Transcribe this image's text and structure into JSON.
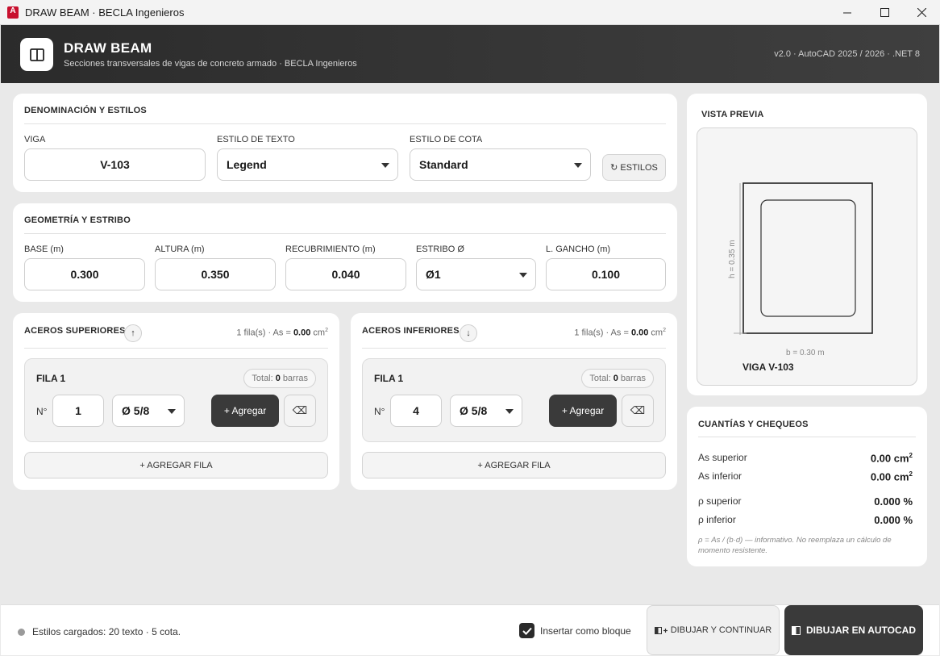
{
  "window": {
    "title": "DRAW BEAM · BECLA Ingenieros",
    "app_icon_letter": "A"
  },
  "header": {
    "title": "DRAW BEAM",
    "subtitle": "Secciones transversales de vigas de concreto armado · BECLA Ingenieros",
    "version": "v2.0 · AutoCAD 2025 / 2026 · .NET 8"
  },
  "denominacion": {
    "title": "DENOMINACIÓN Y ESTILOS",
    "viga_label": "VIGA",
    "viga_value": "V-103",
    "texto_label": "ESTILO DE TEXTO",
    "texto_value": "Legend",
    "cota_label": "ESTILO DE COTA",
    "cota_value": "Standard",
    "estilos_button": "↻ ESTILOS"
  },
  "geometria": {
    "title": "GEOMETRÍA Y ESTRIBO",
    "base_label": "BASE (m)",
    "base_value": "0.300",
    "altura_label": "ALTURA (m)",
    "altura_value": "0.350",
    "recub_label": "RECUBRIMIENTO (m)",
    "recub_value": "0.040",
    "estribo_label": "ESTRIBO Ø",
    "estribo_value": "Ø1",
    "gancho_label": "L. GANCHO (m)",
    "gancho_value": "0.100"
  },
  "superiores": {
    "title": "ACEROS SUPERIORES",
    "arrow": "↑",
    "info_prefix": "1 fila(s) · As = ",
    "info_value": "0.00",
    "info_unit": "cm",
    "info_exp": "2",
    "row_title": "FILA 1",
    "total_prefix": "Total:",
    "total_value": "0",
    "total_suffix": "barras",
    "n_label": "N°",
    "n_value": "1",
    "diam_value": "Ø 5/8",
    "add_button": "+ Agregar",
    "clear_icon": "⌫",
    "add_row_button": "+ AGREGAR FILA"
  },
  "inferiores": {
    "title": "ACEROS INFERIORES",
    "arrow": "↓",
    "info_prefix": "1 fila(s) · As = ",
    "info_value": "0.00",
    "info_unit": "cm",
    "info_exp": "2",
    "row_title": "FILA 1",
    "total_prefix": "Total:",
    "total_value": "0",
    "total_suffix": "barras",
    "n_label": "N°",
    "n_value": "4",
    "diam_value": "Ø 5/8",
    "add_button": "+ Agregar",
    "clear_icon": "⌫",
    "add_row_button": "+ AGREGAR FILA"
  },
  "preview": {
    "title": "VISTA PREVIA",
    "h_label": "h = 0.35 m",
    "b_label": "b = 0.30 m",
    "beam_name": "VIGA V-103"
  },
  "cuantias": {
    "title": "CUANTÍAS Y CHEQUEOS",
    "as_sup_label": "As superior",
    "as_sup_value": "0.00 cm",
    "as_inf_label": "As inferior",
    "as_inf_value": "0.00 cm",
    "unit_exp": "2",
    "rho_sup_label": "ρ superior",
    "rho_sup_value": "0.000 %",
    "rho_inf_label": "ρ inferior",
    "rho_inf_value": "0.000 %",
    "note": "ρ = As / (b·d) — informativo. No reemplaza un cálculo de momento resistente."
  },
  "footer": {
    "status": "Estilos cargados: 20 texto · 5 cota.",
    "checkbox_label": "Insertar como bloque",
    "continue_button": "DIBUJAR Y CONTINUAR",
    "draw_button": "DIBUJAR EN AUTOCAD"
  },
  "colors": {
    "header_dark": "#2b2b2b",
    "button_dark": "#3a3a3a",
    "app_icon": "#c8102e"
  }
}
